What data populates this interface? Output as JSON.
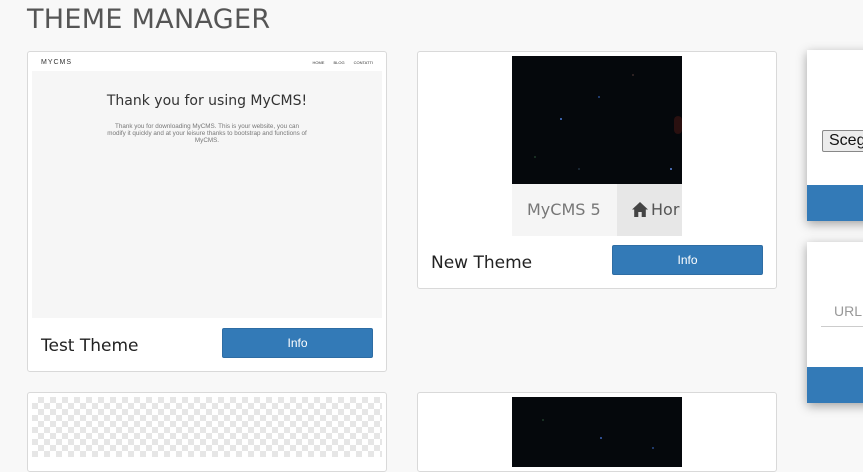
{
  "page": {
    "title": "THEME MANAGER"
  },
  "themes": [
    {
      "name": "Test Theme",
      "info_label": "Info",
      "preview": {
        "logo": "MYCMS",
        "nav_links": [
          "HOME",
          "BLOG",
          "CONTATTI"
        ],
        "heading": "Thank you for using MyCMS!",
        "text": "Thank you for downloading MyCMS. This is your website, you can modify it quickly and at your leisure thanks to bootstrap and functions of MyCMS."
      }
    },
    {
      "name": "New Theme",
      "info_label": "Info",
      "preview": {
        "brand": "MyCMS 5",
        "home_label": "Hor"
      }
    },
    {
      "name": "",
      "info_label": ""
    },
    {
      "name": "",
      "info_label": ""
    }
  ],
  "side_panels": {
    "upload": {
      "file_button_label": "Sceg"
    },
    "url": {
      "placeholder": "URL"
    }
  },
  "colors": {
    "accent": "#337ab7",
    "background": "#f8f8f8"
  },
  "icons": {
    "home": "home-icon"
  }
}
